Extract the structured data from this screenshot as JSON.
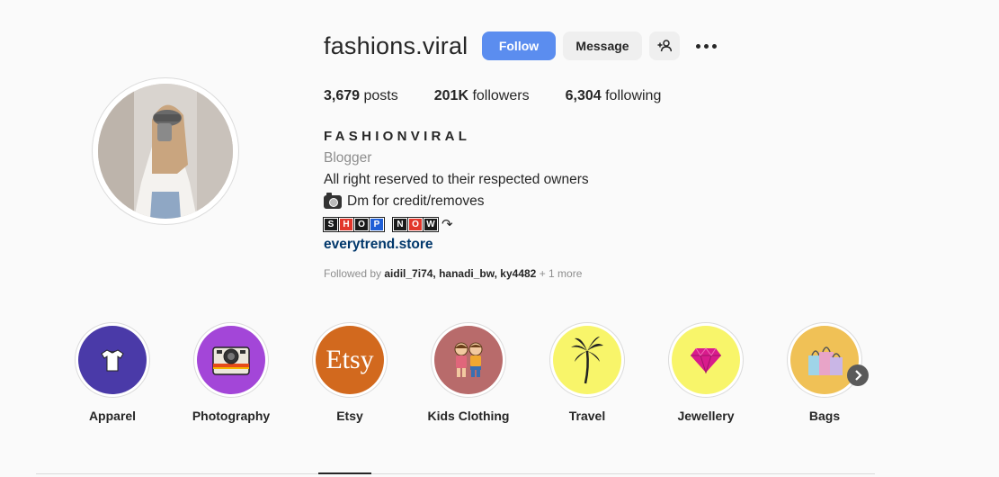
{
  "profile": {
    "username": "fashions.viral",
    "follow_label": "Follow",
    "message_label": "Message",
    "stats": {
      "posts_count": "3,679",
      "posts_label": "posts",
      "followers_count": "201K",
      "followers_label": "followers",
      "following_count": "6,304",
      "following_label": "following"
    },
    "full_name": "FASHIONVIRAL",
    "category": "Blogger",
    "bio_line1": "All right reserved to their respected owners",
    "bio_line2": "Dm for credit/removes",
    "shop_now": {
      "word1": [
        "S",
        "H",
        "O",
        "P"
      ],
      "word2": [
        "N",
        "O",
        "W"
      ],
      "arrow": "↷"
    },
    "link": "everytrend.store",
    "followed_by": {
      "prefix": "Followed by",
      "names": "aidil_7i74, hanadi_bw, ky4482",
      "more": "+ 1 more"
    }
  },
  "highlights": [
    {
      "label": "Apparel",
      "icon": "tshirt-icon",
      "bg": "#4a3aa8"
    },
    {
      "label": "Photography",
      "icon": "camera-icon",
      "bg": "#a346d8"
    },
    {
      "label": "Etsy",
      "icon": "etsy-logo",
      "bg": "#d2691e",
      "logo_text": "Etsy"
    },
    {
      "label": "Kids Clothing",
      "icon": "kids-icon",
      "bg": "#b86b6b"
    },
    {
      "label": "Travel",
      "icon": "palm-tree-icon",
      "bg": "#f8f56a"
    },
    {
      "label": "Jewellery",
      "icon": "gem-icon",
      "bg": "#f8f56a"
    },
    {
      "label": "Bags",
      "icon": "shopping-bags-icon",
      "bg": "#f0c156"
    }
  ],
  "colors": {
    "follow_button": "#5b8def",
    "link": "#00376b",
    "muted": "#8e8e8e"
  },
  "icons": {
    "suggest": "add-person-icon",
    "more": "more-dots-icon",
    "next": "chevron-right-icon",
    "bio_camera": "camera-emoji-icon"
  }
}
